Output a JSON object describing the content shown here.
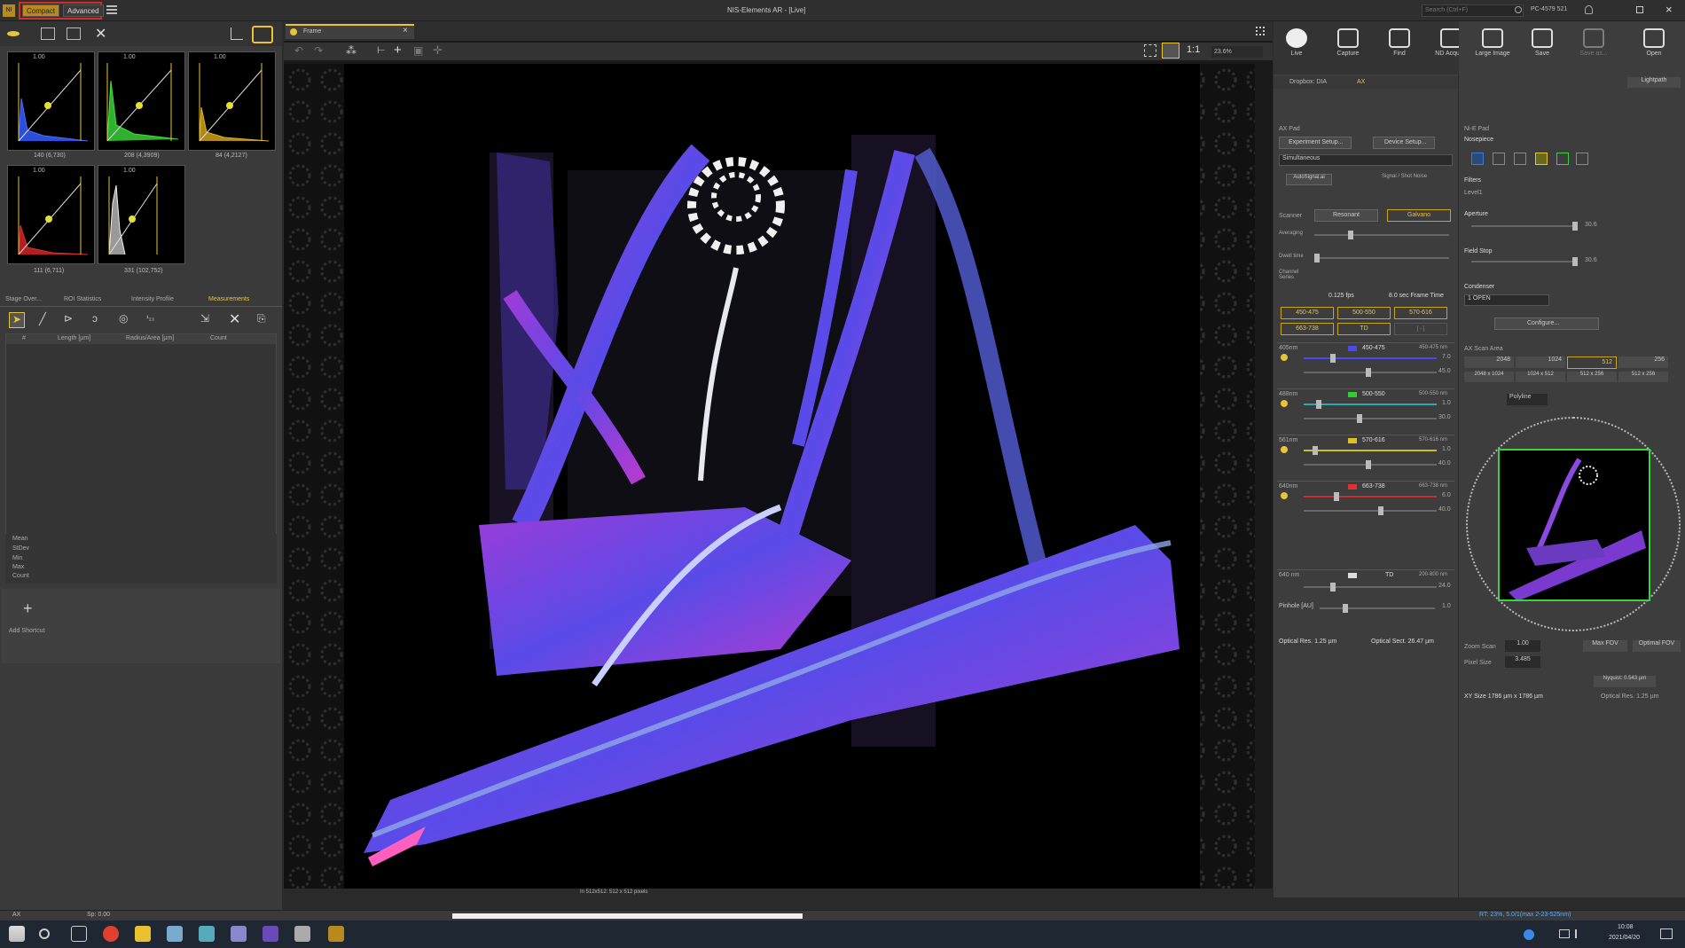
{
  "window": {
    "title": "NIS-Elements AR - [Live]",
    "search_placeholder": "Search (Ctrl+F)",
    "pc_info": "PC-4579 521"
  },
  "modes": {
    "compact": "Compact",
    "advanced": "Advanced"
  },
  "luts": [
    {
      "header": "1.00",
      "label": "140 (6,730)",
      "color": "#2b4fd9"
    },
    {
      "header": "1.00",
      "label": "208 (4,3909)",
      "color": "#38d43a"
    },
    {
      "header": "1.00",
      "label": "84 (4,2127)",
      "color": "#d4b01d"
    },
    {
      "header": "1.00",
      "label": "111 (6,711)",
      "color": "#d42b2b"
    },
    {
      "header": "1.00",
      "label": "331 (102,752)",
      "color": "#d0d0d0"
    }
  ],
  "left_tabs": [
    "Stage Over...",
    "ROI Statistics",
    "Intensity Profile",
    "Measurements"
  ],
  "measure_headers": [
    "#",
    "Length [µm]",
    "Radius/Area [µm]",
    "Count"
  ],
  "stats": [
    "Mean",
    "StDev",
    "Min",
    "Max",
    "Count"
  ],
  "add_shortcut": "Add Shortcut",
  "image_tab": "Frame",
  "zoom": "23.6%",
  "ratio": "1:1",
  "toolbar": [
    {
      "label": "Live",
      "icon": "play-icon"
    },
    {
      "label": "Capture",
      "icon": "camera-icon"
    },
    {
      "label": "Find",
      "icon": "find-icon"
    },
    {
      "label": "ND Acquire",
      "icon": "nd-icon"
    },
    {
      "label": "Large Image",
      "icon": "large-image-icon"
    },
    {
      "label": "Save",
      "icon": "save-icon"
    },
    {
      "label": "Save as...",
      "icon": "save-as-icon"
    },
    {
      "label": "Open",
      "icon": "open-icon"
    }
  ],
  "acq": {
    "tabs": [
      "Dropbox: DIA",
      "AX"
    ],
    "lightpath": "Lightpath",
    "ax_pad": "AX Pad",
    "experiment_setup": "Experiment Setup...",
    "device_setup": "Device Setup...",
    "mode": "Simultaneous",
    "autosignal": "AutoSignal.ai",
    "signal_noise": "Signal / Shot Noise",
    "scanner_label": "Scanner",
    "scanner_speed": "Resonant",
    "scanner_mode": "Galvano",
    "averaging": "Averaging",
    "dwell": "Dwell time",
    "channel_series": "Channel Series",
    "fps": "0.125 fps",
    "frame_time": "8.0 sec Frame Time",
    "filters": [
      "450-475",
      "500-550",
      "570-616",
      "663-738",
      "TD",
      "[ - ]"
    ],
    "channels": [
      {
        "line": "405nm",
        "name": "450-475",
        "range": "450-475 nm",
        "color": "#4a4af0",
        "laser": "7.0",
        "gain": "45.0"
      },
      {
        "line": "488nm",
        "name": "500-550",
        "range": "500-550 nm",
        "color": "#33cc33",
        "laser": "1.0",
        "gain": "30.0"
      },
      {
        "line": "561nm",
        "name": "570-616",
        "range": "570-616 nm",
        "color": "#e0c020",
        "laser": "1.0",
        "gain": "40.0"
      },
      {
        "line": "640nm",
        "name": "663-738",
        "range": "663-738 nm",
        "color": "#e03030",
        "laser": "6.0",
        "gain": "40.0"
      },
      {
        "line": "640 nm",
        "name": "TD",
        "range": "200-800 nm",
        "color": "#dddddd",
        "laser": "",
        "gain": "24.0"
      }
    ],
    "pinhole": "Pinhole [AU]",
    "pinhole_val": "1.0",
    "optical_res": "Optical Res. 1.25 µm",
    "optical_sect": "Optical Sect. 26.47 µm"
  },
  "nd": {
    "title": "Ni-E Pad",
    "nosepiece": "Nosepiece",
    "filters": "Filters",
    "level": "Level1",
    "aperture": "Aperture",
    "aperture_val": "30.6",
    "field_stop": "Field Stop",
    "field_stop_val": "30.6",
    "condenser": "Condenser",
    "condenser_val": "1 OPEN",
    "configure": "Configure...",
    "scan_area": "AX Scan Area",
    "sizes": [
      "2048",
      "1024",
      "512",
      "256"
    ],
    "sizes2": [
      "2048 x 1024",
      "1024 x 512",
      "512 x 256",
      "512 x 256"
    ],
    "polyline": "Polyline",
    "zoom_scan": "Zoom Scan",
    "zoom_val": "1.00",
    "pixel_size": "Pixel Size",
    "pixel_val": "3.485",
    "max_fov": "Max FOV",
    "optimal_fov": "Optimal FOV",
    "nyquist": "Nyquist: 0.543 µm",
    "fov_info": "XY Size 1786 µm x 1786 µm",
    "optical_res": "Optical Res. 1.25 µm"
  },
  "status": {
    "left": "AX",
    "mid": "Sp: 0.00",
    "image_info": "In 512x512: 512 x 512 pixels",
    "right": "RT: 23%, 5.0/1(max 2-23-525nm)"
  },
  "clock": {
    "time": "10:08",
    "date": "2021/04/20"
  },
  "colors": {
    "accent": "#e8c43a",
    "highlight": "#d42b2b",
    "selected": "#38d43a"
  }
}
